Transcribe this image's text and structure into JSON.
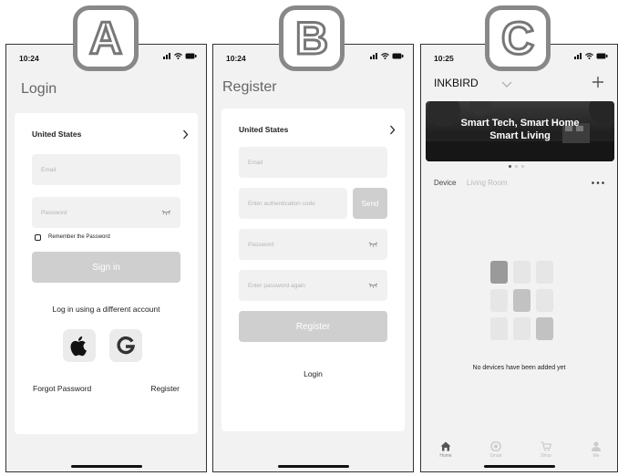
{
  "badges": {
    "a": "A",
    "b": "B",
    "c": "C"
  },
  "login": {
    "time": "10:24",
    "title": "Login",
    "country": "United States",
    "email_placeholder": "Email",
    "password_placeholder": "Password",
    "remember": "Remember the Password",
    "sign_in": "Sign in",
    "alt_login": "Log in using a different account",
    "forgot": "Forgot Password",
    "register": "Register"
  },
  "register": {
    "time": "10:24",
    "title": "Register",
    "country": "United States",
    "email_placeholder": "Email",
    "auth_placeholder": "Enter authentication code",
    "send": "Send",
    "password_placeholder": "Password",
    "password_again_placeholder": "Enter password again",
    "register_button": "Register",
    "login_link": "Login"
  },
  "home": {
    "time": "10:25",
    "brand": "INKBIRD",
    "banner_line1": "Smart Tech, Smart Home",
    "banner_line2": "Smart Living",
    "tab_device": "Device",
    "tab_room": "Living Room",
    "empty": "No devices have been added yet",
    "nav": [
      "Home",
      "Smart",
      "Shop",
      "Me"
    ],
    "colors": {
      "active_tile": "#9a9a9a",
      "mid_tile": "#c2c2c2",
      "idle_tile": "#e6e6e6"
    }
  },
  "icons": [
    "signal-icon",
    "wifi-icon",
    "battery-icon",
    "chevron-right-icon",
    "eye-off-icon",
    "apple-icon",
    "google-icon",
    "chevron-down-icon",
    "plus-icon",
    "more-icon",
    "home-icon",
    "smart-icon",
    "shop-icon",
    "me-icon"
  ]
}
